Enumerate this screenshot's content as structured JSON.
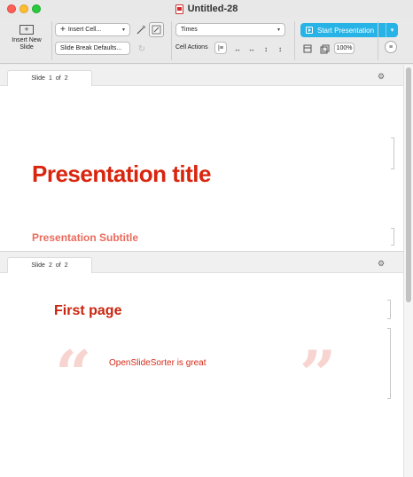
{
  "window": {
    "title": "Untitled-28"
  },
  "toolbar": {
    "insert_slide_label": "Insert New Slide",
    "insert_cell_label": "Insert Cell...",
    "slide_break_label": "Slide Break Defaults...",
    "font_value": "Times",
    "cell_actions_label": "Cell Actions",
    "start_presentation_label": "Start Presentation",
    "zoom_value": "100%"
  },
  "slides": [
    {
      "tab_label": "Slide",
      "index": "1",
      "of": "of",
      "total": "2",
      "title": "Presentation title",
      "subtitle": "Presentation Subtitle"
    },
    {
      "tab_label": "Slide",
      "index": "2",
      "of": "of",
      "total": "2",
      "heading": "First page",
      "quote_open": "“",
      "quote_text": "OpenSlideSorter is great",
      "quote_close": "”"
    }
  ],
  "colors": {
    "title_red": "#d9250e",
    "subtitle_salmon": "#e96b5d",
    "accent_blue": "#27b3e6",
    "quote_pink": "#f7d4d0"
  }
}
